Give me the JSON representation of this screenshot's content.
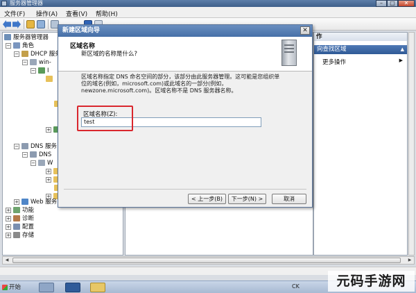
{
  "window": {
    "title": "服务器管理器"
  },
  "menu": [
    "文件(F)",
    "操作(A)",
    "查看(V)",
    "帮助(H)"
  ],
  "tree": {
    "items": [
      {
        "label": "服务器管理器"
      },
      {
        "label": "角色"
      },
      {
        "label": "DHCP 服务"
      },
      {
        "label": "win-"
      },
      {
        "label": "I"
      },
      {
        "label": ""
      },
      {
        "label": ""
      },
      {
        "label": "I"
      },
      {
        "label": "DNS 服务"
      },
      {
        "label": "DNS"
      },
      {
        "label": "W"
      },
      {
        "label": "Web 服务"
      },
      {
        "label": "功能"
      },
      {
        "label": "诊断"
      },
      {
        "label": "配置"
      },
      {
        "label": "存储"
      }
    ]
  },
  "actions": {
    "header": "作",
    "selected": "向查找区域",
    "more": "更多操作"
  },
  "dialog": {
    "title": "新建区域向导",
    "close_glyph": "✕",
    "heading": "区域名称",
    "subheading": "新区域的名称是什么?",
    "description": [
      "区域名称指定 DNS 命名空间的部分，该部分由此服务器管理。这可能是您组织单",
      "位的域名(例如，microsoft.com)或此域名的一部分(例如，",
      "newzone.microsoft.com)。区域名称不是 DNS 服务器名称。"
    ],
    "zone_name_label": "区域名称(Z):",
    "zone_name_value": "test",
    "back_button": "< 上一步(B)",
    "next_button": "下一步(N) >",
    "cancel_button": "取消"
  },
  "taskbar": {
    "start": "开始",
    "lang": "CK"
  },
  "watermark": "元码手游网",
  "colors": {
    "dialog_title": "#4670a8",
    "highlight_box": "#d9262d",
    "action_selected": "#2f5a96"
  }
}
